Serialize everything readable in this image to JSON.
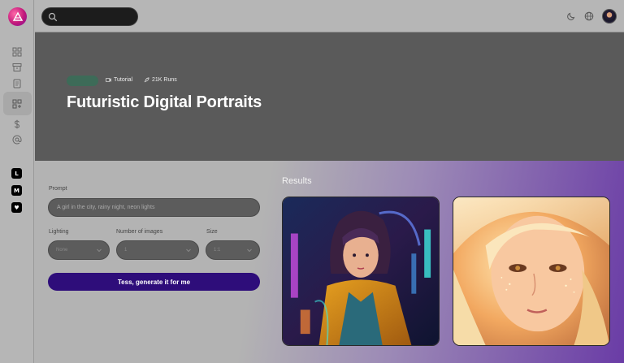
{
  "header": {
    "search_placeholder": "",
    "icons": [
      "moon-icon",
      "globe-icon"
    ]
  },
  "sidebar": {
    "items": [
      {
        "icon": "grid-icon"
      },
      {
        "icon": "archive-icon"
      },
      {
        "icon": "document-icon"
      },
      {
        "icon": "apps-icon",
        "active": true
      },
      {
        "icon": "dollar-icon"
      },
      {
        "icon": "at-sign-icon"
      }
    ],
    "social": [
      {
        "label": "L"
      },
      {
        "label": "M"
      },
      {
        "label": "♥"
      }
    ]
  },
  "hero": {
    "tag": "",
    "tutorial_label": "Tutorial",
    "runs_label": "21K Runs",
    "title": "Futuristic Digital Portraits"
  },
  "form": {
    "prompt_label": "Prompt",
    "prompt_value": "A girl in the city, rainy night, neon lights",
    "lighting_label": "Lighting",
    "lighting_value": "None",
    "images_label": "Number of images",
    "images_value": "1",
    "size_label": "Size",
    "size_value": "1:1",
    "generate_label": "Tess, generate it for me"
  },
  "results": {
    "title": "Results"
  },
  "colors": {
    "accent": "#2e0d7a",
    "hero_bg": "#5a5a5a",
    "tag_green": "#3d6b58"
  }
}
